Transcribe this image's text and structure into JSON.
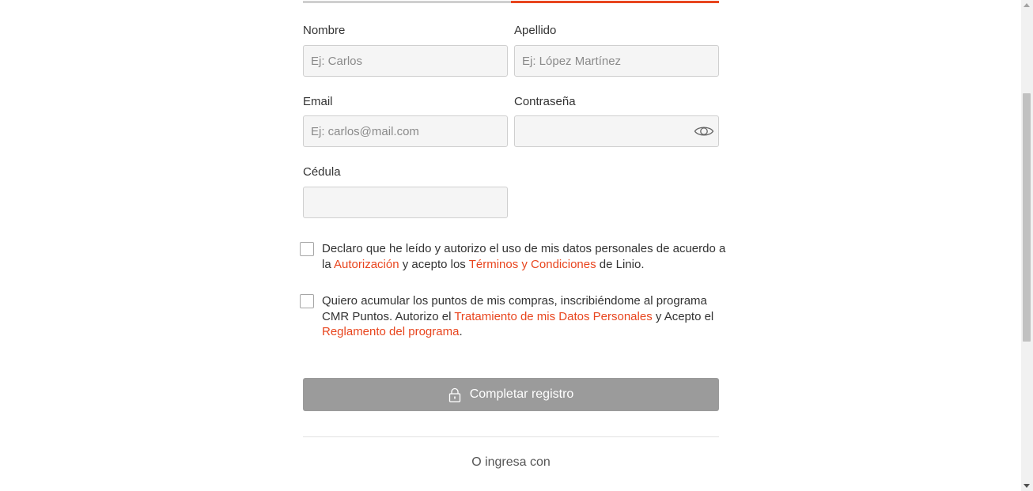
{
  "form": {
    "nombre": {
      "label": "Nombre",
      "placeholder": "Ej: Carlos"
    },
    "apellido": {
      "label": "Apellido",
      "placeholder": "Ej: López Martínez"
    },
    "email": {
      "label": "Email",
      "placeholder": "Ej: carlos@mail.com"
    },
    "password": {
      "label": "Contraseña",
      "placeholder": ""
    },
    "cedula": {
      "label": "Cédula",
      "placeholder": ""
    }
  },
  "consent_terms": {
    "checked": false,
    "text_1": "Declaro que he leído y autorizo el uso de mis datos personales de acuerdo a la",
    "link_authorization": "Autorización",
    "text_2": "y acepto los",
    "link_terms": "Términos y Condiciones",
    "text_3": "de Linio."
  },
  "consent_cmr": {
    "checked": false,
    "text_1": "Quiero acumular los puntos de mis compras, inscribiéndome al programa CMR Puntos. Autorizo el",
    "link_data": "Tratamiento de mis Datos Personales",
    "text_2": "y Acepto el",
    "link_rules": "Reglamento del programa",
    "text_3": "."
  },
  "submit": {
    "label": "Completar registro",
    "icon": "lock-icon"
  },
  "alt_login": {
    "label": "O ingresa con"
  },
  "colors": {
    "accent": "#e8451e",
    "button_disabled": "#9b9b9b",
    "field_bg": "#f5f5f5"
  },
  "progress": {
    "steps_total": 2,
    "current_step": 2
  }
}
